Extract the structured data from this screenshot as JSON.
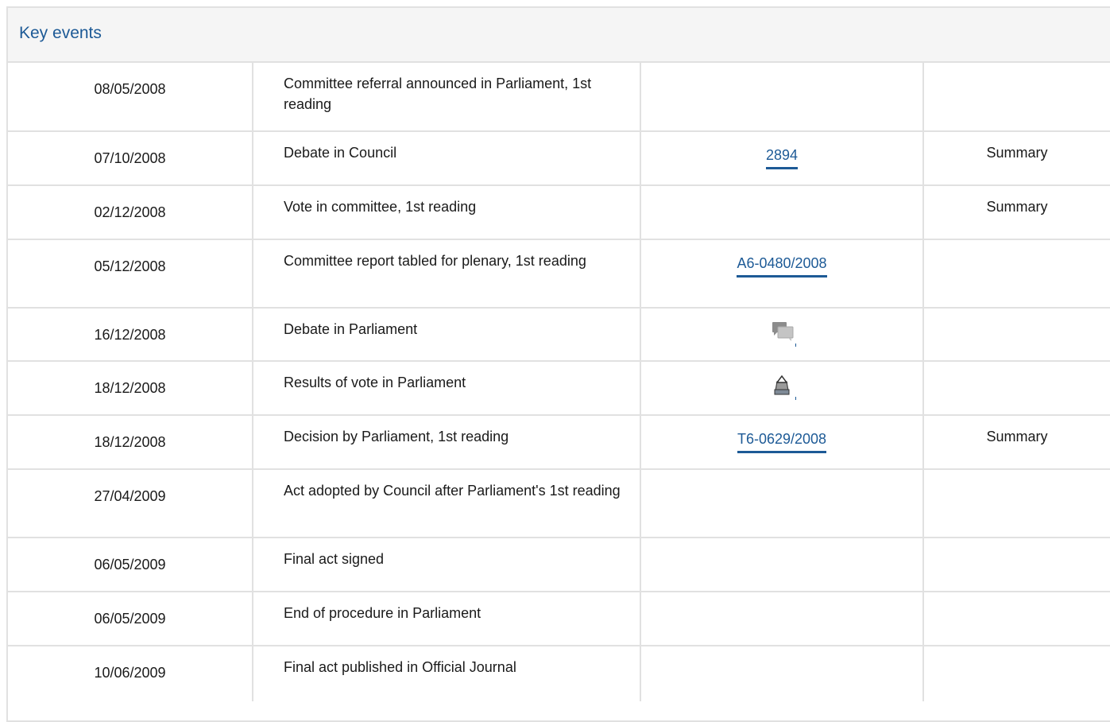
{
  "panel": {
    "title": "Key events"
  },
  "rows": [
    {
      "date": "08/05/2008",
      "event": "Committee referral announced in Parliament, 1st reading",
      "ref": "",
      "summary": ""
    },
    {
      "date": "07/10/2008",
      "event": "Debate in Council",
      "ref": "2894",
      "summary": "Summary"
    },
    {
      "date": "02/12/2008",
      "event": "Vote in committee, 1st reading",
      "ref": "",
      "summary": "Summary"
    },
    {
      "date": "05/12/2008",
      "event": "Committee report tabled for plenary, 1st reading",
      "ref": "A6-0480/2008",
      "summary": ""
    },
    {
      "date": "16/12/2008",
      "event": "Debate in Parliament",
      "ref_icon": "debate-speech-bubbles-icon",
      "summary": ""
    },
    {
      "date": "18/12/2008",
      "event": "Results of vote in Parliament",
      "ref_icon": "ballot-box-vote-icon",
      "summary": ""
    },
    {
      "date": "18/12/2008",
      "event": "Decision by Parliament, 1st reading",
      "ref": "T6-0629/2008",
      "summary": "Summary"
    },
    {
      "date": "27/04/2009",
      "event": "Act adopted by Council after Parliament's 1st reading",
      "ref": "",
      "summary": ""
    },
    {
      "date": "06/05/2009",
      "event": "Final act signed",
      "ref": "",
      "summary": ""
    },
    {
      "date": "06/05/2009",
      "event": "End of procedure in Parliament",
      "ref": "",
      "summary": ""
    },
    {
      "date": "10/06/2009",
      "event": "Final act published in Official Journal",
      "ref": "",
      "summary": ""
    }
  ],
  "colors": {
    "link": "#1d5a96",
    "header_bg": "#f5f5f5",
    "border": "#e1e1e1"
  }
}
